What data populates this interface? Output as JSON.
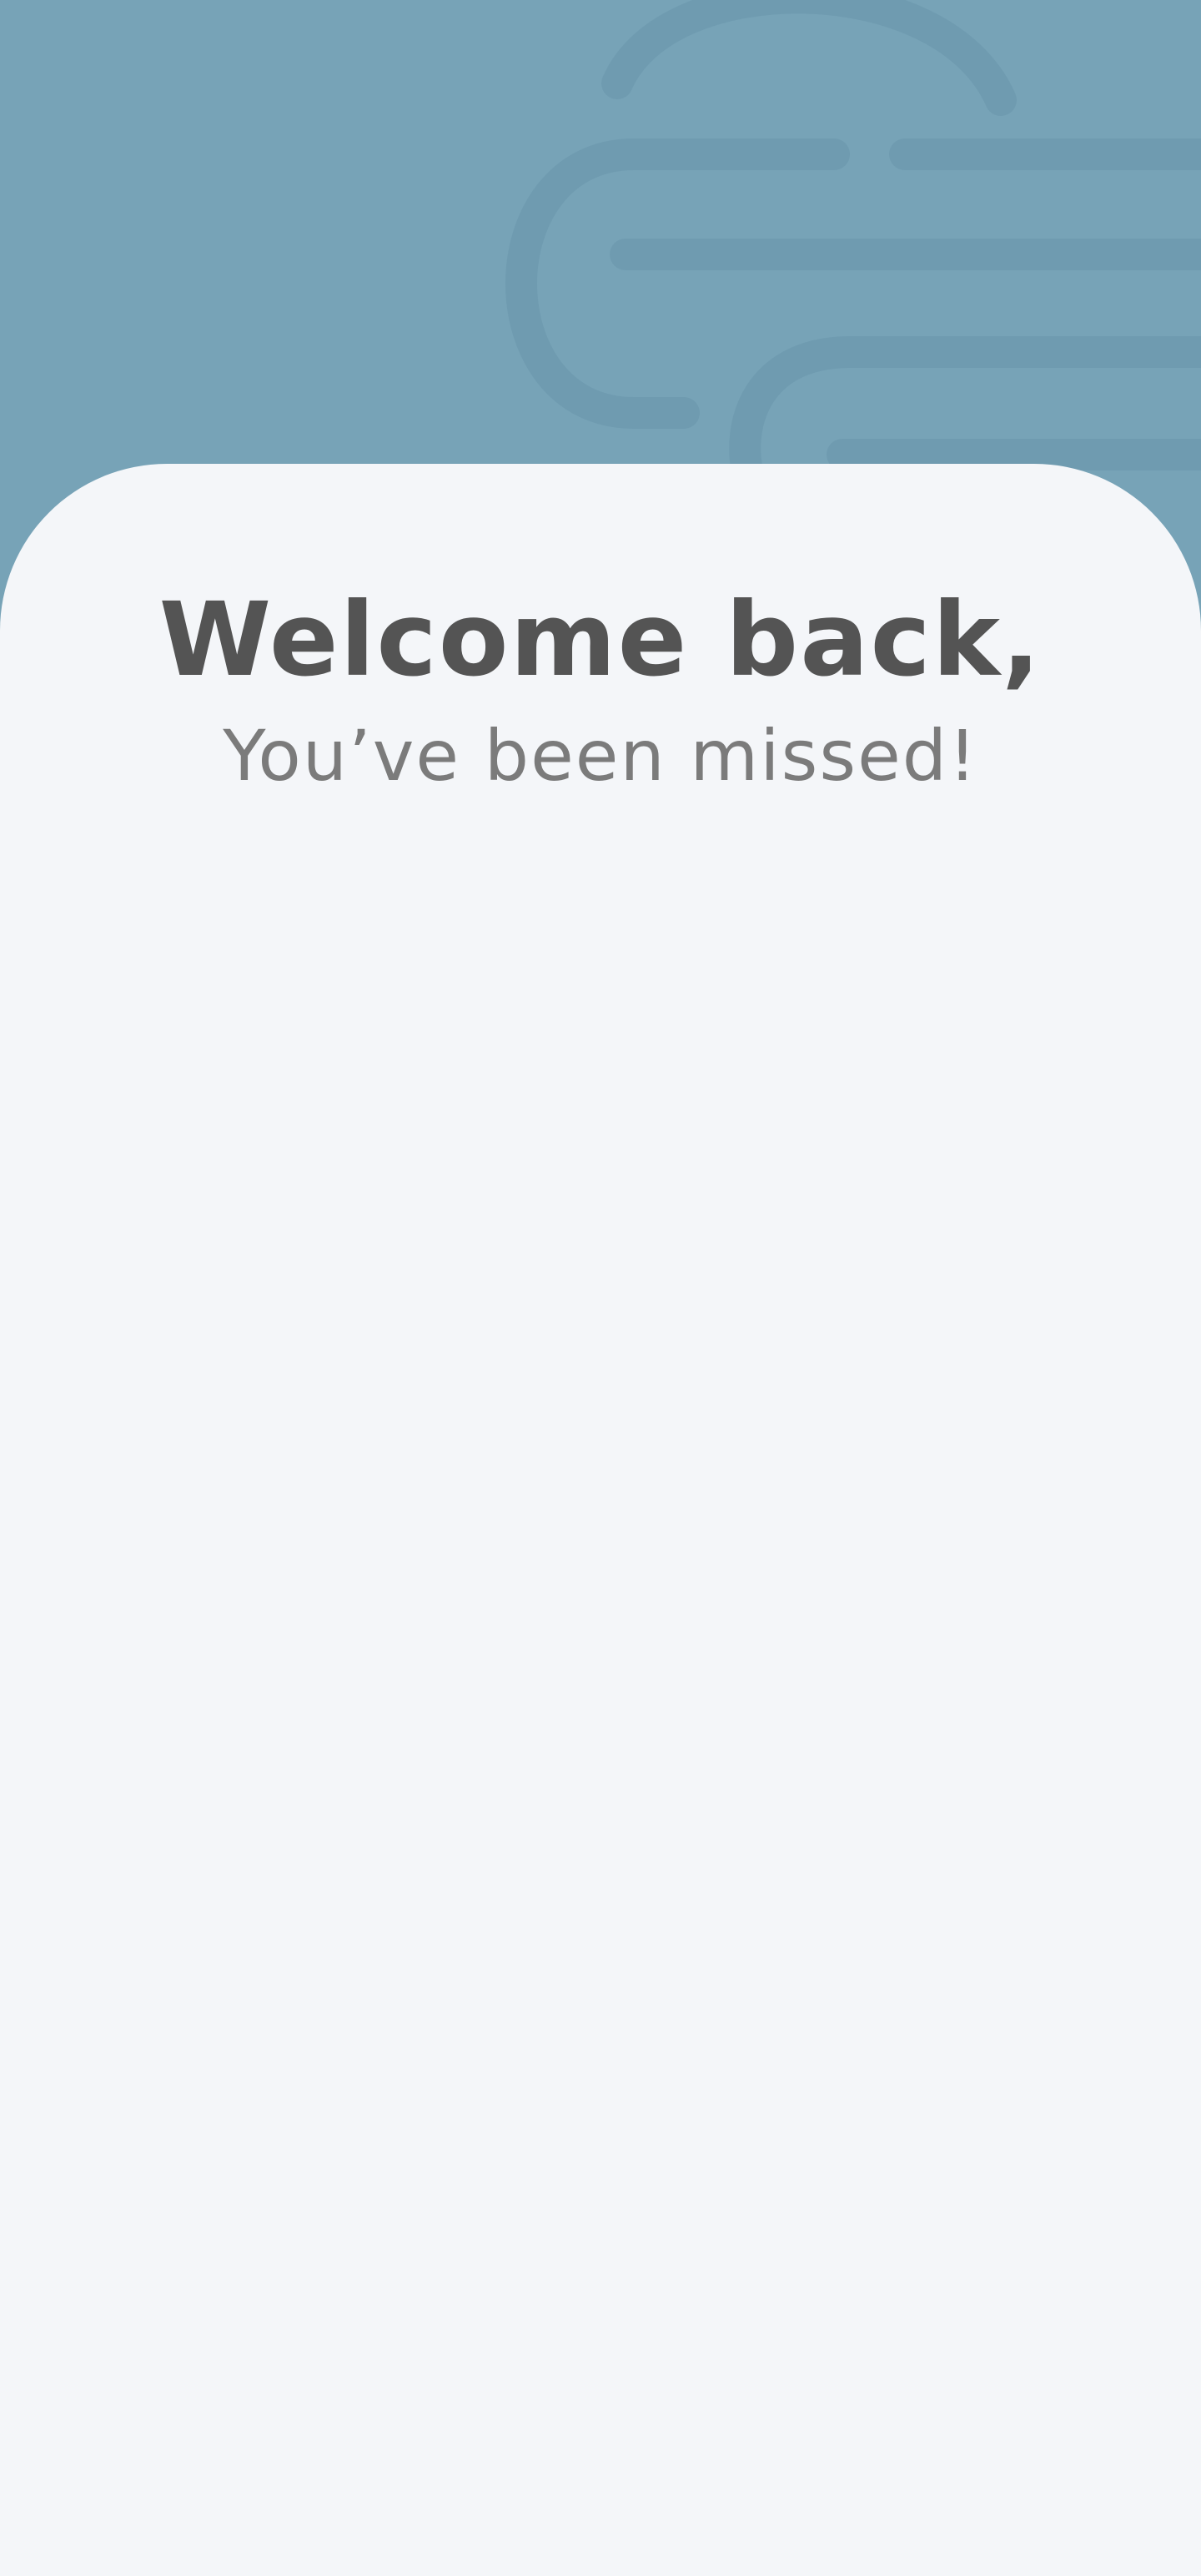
{
  "header": {
    "background_color": "#77a3b7",
    "decoration_color": "#6f9bb0",
    "decoration": "faint outline illustration (rounded bars and arcs)"
  },
  "card": {
    "background_color": "#f4f6f9",
    "title": "Welcome back,",
    "subtitle": "You’ve been missed!",
    "title_color": "#545454",
    "subtitle_color": "#7b7b7b"
  }
}
